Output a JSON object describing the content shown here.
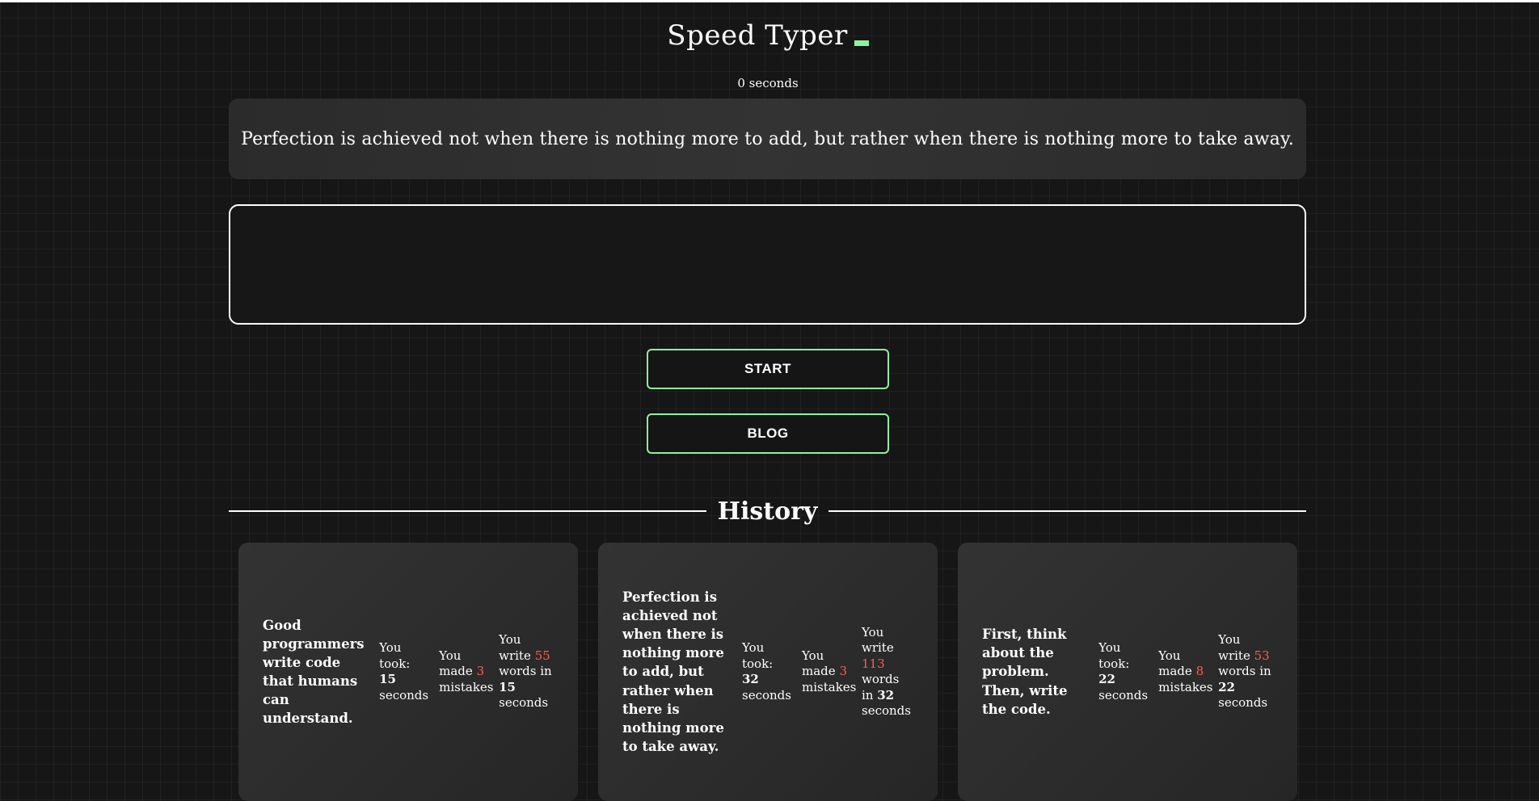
{
  "app": {
    "title": "Speed Typer",
    "timer_value": "0",
    "timer_unit": "seconds"
  },
  "quote": {
    "text": "Perfection is achieved not when there is nothing more to add, but rather when there is nothing more to take away."
  },
  "input": {
    "value": "",
    "placeholder": ""
  },
  "buttons": {
    "start_label": "START",
    "blog_label": "BLOG"
  },
  "history": {
    "title": "History",
    "cards": [
      {
        "quote": "Good programmers write code that humans can understand.",
        "took_prefix": "You took:",
        "took_value": "15",
        "took_unit": "seconds",
        "mistakes_prefix": "You made",
        "mistakes_value": "3",
        "mistakes_unit": "mistakes",
        "words_prefix": "You write",
        "words_value": "55",
        "words_mid": "words in",
        "words_time": "15",
        "words_unit": "seconds"
      },
      {
        "quote": "Perfection is achieved not when there is nothing more to add, but rather when there is nothing more to take away.",
        "took_prefix": "You took:",
        "took_value": "32",
        "took_unit": "seconds",
        "mistakes_prefix": "You made",
        "mistakes_value": "3",
        "mistakes_unit": "mistakes",
        "words_prefix": "You write",
        "words_value": "113",
        "words_mid": "words in",
        "words_time": "32",
        "words_unit": "seconds"
      },
      {
        "quote": "First, think about the problem. Then, write the code.",
        "took_prefix": "You took:",
        "took_value": "22",
        "took_unit": "seconds",
        "mistakes_prefix": "You made",
        "mistakes_value": "8",
        "mistakes_unit": "mistakes",
        "words_prefix": "You write",
        "words_value": "53",
        "words_mid": "words in",
        "words_time": "22",
        "words_unit": "seconds"
      }
    ]
  },
  "colors": {
    "background": "#161616",
    "accent": "#8ef29f",
    "highlight": "#ff5a5a",
    "text": "#ffffff"
  }
}
